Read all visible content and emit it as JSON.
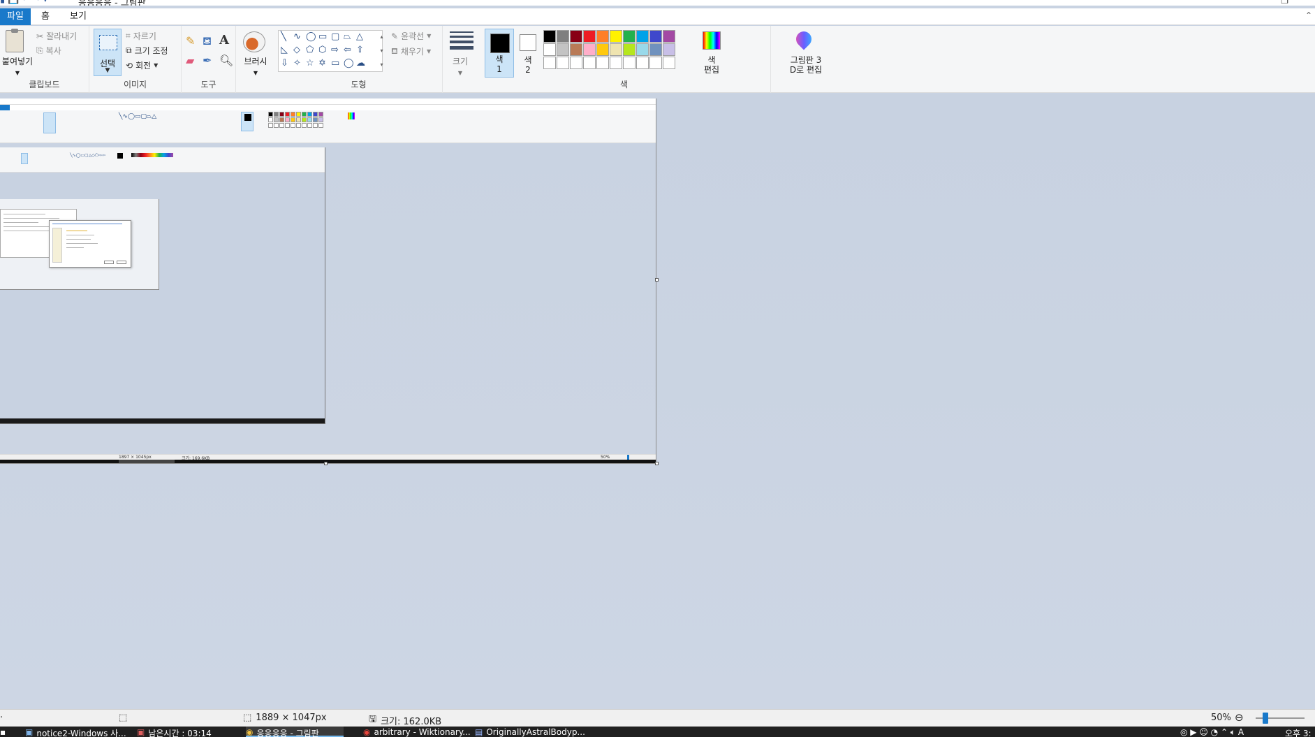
{
  "window": {
    "title": "응응응응 - 그림판",
    "restore_icon": "restore-icon"
  },
  "tabs": [
    {
      "label": "파일"
    },
    {
      "label": "홈"
    },
    {
      "label": "보기"
    }
  ],
  "ribbon": {
    "clipboard": {
      "group_label": "클립보드",
      "paste": "붙여넣기",
      "cut": "잘라내기",
      "copy": "복사"
    },
    "image": {
      "group_label": "이미지",
      "select": "선택",
      "crop": "자르기",
      "resize": "크기 조정",
      "rotate": "회전"
    },
    "tools": {
      "group_label": "도구"
    },
    "brushes": {
      "label": "브러시"
    },
    "shapes": {
      "group_label": "도형",
      "outline": "윤곽선",
      "fill": "채우기"
    },
    "size": {
      "label": "크기"
    },
    "colors": {
      "group_label": "색",
      "color1": "색\n1",
      "color1_line1": "색",
      "color1_line2": "1",
      "color2_line1": "색",
      "color2_line2": "2",
      "edit_colors_line1": "색",
      "edit_colors_line2": "편집",
      "paint3d_line1": "그림판 3",
      "paint3d_line2": "D로 편집",
      "palette_row1": [
        "#000000",
        "#7f7f7f",
        "#880015",
        "#ed1c24",
        "#ff7f27",
        "#fff200",
        "#22b14c",
        "#00a2e8",
        "#3f48cc",
        "#a349a4"
      ],
      "palette_row2": [
        "#ffffff",
        "#c3c3c3",
        "#b97a57",
        "#ffaec9",
        "#ffc90e",
        "#efe4b0",
        "#b5e61d",
        "#99d9ea",
        "#7092be",
        "#c8bfe7"
      ],
      "palette_row3": [
        "#ffffff",
        "#ffffff",
        "#ffffff",
        "#ffffff",
        "#ffffff",
        "#ffffff",
        "#ffffff",
        "#ffffff",
        "#ffffff",
        "#ffffff"
      ]
    }
  },
  "status": {
    "dimensions": "1889 × 1047px",
    "file_size": "크기: 162.0KB",
    "zoom": "50%"
  },
  "taskbar": {
    "items": [
      {
        "label": "notice2-Windows 사..."
      },
      {
        "label": "남은시간 : 03:14"
      },
      {
        "label": "응응응응 - 그림판"
      },
      {
        "label": "arbitrary - Wiktionary..."
      },
      {
        "label": "OriginallyAstralBodyp..."
      }
    ],
    "clock": "오후 3:"
  },
  "nested": {
    "status_dims": "1897 × 1045px",
    "status_size": "크기: 169.6KB",
    "status_zoom": "50%"
  }
}
